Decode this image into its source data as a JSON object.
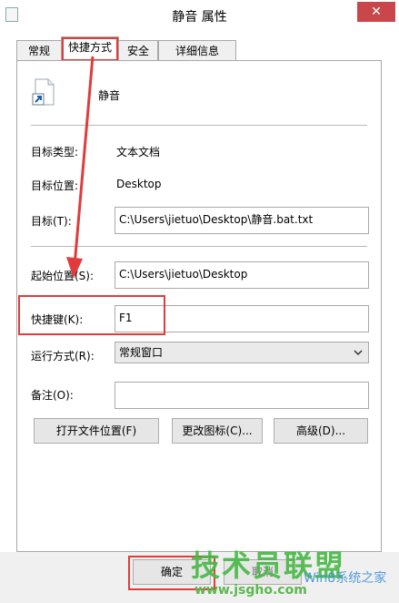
{
  "window": {
    "title": "静音 属性",
    "close_glyph": "✕"
  },
  "tabs": [
    {
      "label": "常规"
    },
    {
      "label": "快捷方式"
    },
    {
      "label": "安全"
    },
    {
      "label": "详细信息"
    }
  ],
  "shortcut": {
    "name": "静音",
    "target_type_label": "目标类型:",
    "target_type_value": "文本文档",
    "target_location_label": "目标位置:",
    "target_location_value": "Desktop",
    "target_label": "目标(T):",
    "target_value": "C:\\Users\\jietuo\\Desktop\\静音.bat.txt",
    "start_in_label": "起始位置(S):",
    "start_in_value": "C:\\Users\\jietuo\\Desktop",
    "hotkey_label": "快捷键(K):",
    "hotkey_value": "F1",
    "run_label": "运行方式(R):",
    "run_value": "常规窗口",
    "comment_label": "备注(O):",
    "comment_value": ""
  },
  "buttons": {
    "open_location": "打开文件位置(F)",
    "change_icon": "更改图标(C)...",
    "advanced": "高级(D)...",
    "ok": "确定",
    "cancel": "取消"
  },
  "watermark": {
    "brand": "技术员联盟",
    "site": "www.jsgho.com",
    "sub": "Win8系统之家"
  },
  "colors": {
    "highlight": "#e03c3c",
    "close_button": "#c9474b"
  }
}
